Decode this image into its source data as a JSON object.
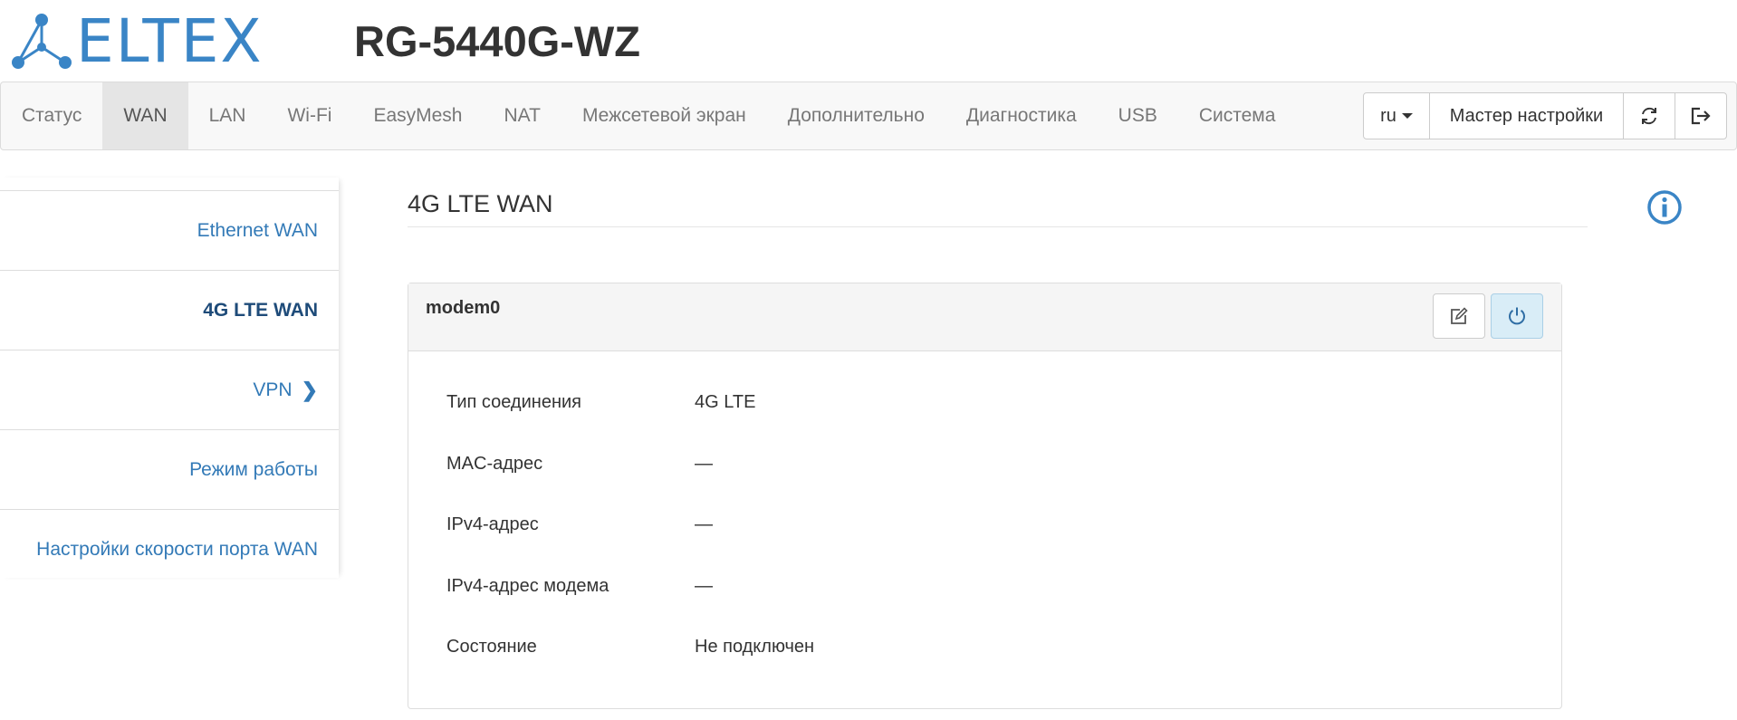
{
  "brand": {
    "logo_text": "ELTEX",
    "model": "RG-5440G-WZ",
    "accent": "#3a85c6"
  },
  "nav": {
    "items": [
      {
        "label": "Статус",
        "active": false
      },
      {
        "label": "WAN",
        "active": true
      },
      {
        "label": "LAN",
        "active": false
      },
      {
        "label": "Wi-Fi",
        "active": false
      },
      {
        "label": "EasyMesh",
        "active": false
      },
      {
        "label": "NAT",
        "active": false
      },
      {
        "label": "Межсетевой экран",
        "active": false
      },
      {
        "label": "Дополнительно",
        "active": false
      },
      {
        "label": "Диагностика",
        "active": false
      },
      {
        "label": "USB",
        "active": false
      },
      {
        "label": "Система",
        "active": false
      }
    ],
    "language": "ru",
    "wizard_label": "Мастер настройки",
    "refresh_icon": "refresh-icon",
    "logout_icon": "logout-icon"
  },
  "sidebar": {
    "items": [
      {
        "label": "Ethernet WAN",
        "active": false
      },
      {
        "label": "4G LTE WAN",
        "active": true
      },
      {
        "label": "VPN",
        "active": false,
        "chevron": "chevron-right-icon"
      },
      {
        "label": "Режим работы",
        "active": false
      },
      {
        "label": "Настройки скорости порта WAN",
        "active": false
      }
    ]
  },
  "main": {
    "title": "4G LTE WAN",
    "info_icon": "info-icon"
  },
  "panel": {
    "title": "modem0",
    "edit_icon": "edit-icon",
    "power_icon": "power-icon",
    "rows": [
      {
        "label": "Тип соединения",
        "value": "4G LTE"
      },
      {
        "label": "MAC-адрес",
        "value": "—"
      },
      {
        "label": "IPv4-адрес",
        "value": "—"
      },
      {
        "label": "IPv4-адрес модема",
        "value": "—"
      },
      {
        "label": "Состояние",
        "value": "Не подключен"
      }
    ]
  }
}
